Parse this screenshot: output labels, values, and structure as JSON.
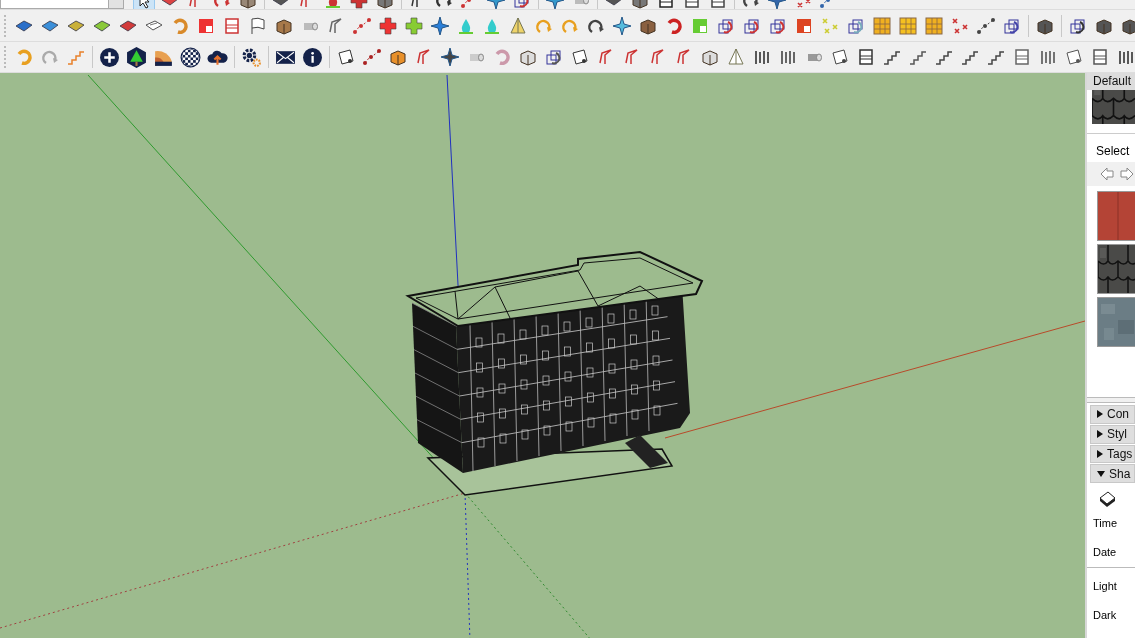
{
  "tray": {
    "materials": {
      "title": "Default",
      "current": {
        "kind": "shingle"
      },
      "select_label": "Select",
      "swatches": [
        {
          "kind": "brick",
          "selected": false
        },
        {
          "kind": "shingle",
          "selected": false
        },
        {
          "kind": "stone",
          "selected": false
        }
      ]
    },
    "sections": [
      {
        "label": "Con",
        "expanded": false
      },
      {
        "label": "Styl",
        "expanded": false
      },
      {
        "label": "Tags",
        "expanded": false
      },
      {
        "label": "Sha",
        "expanded": true,
        "fields": [
          {
            "label": "Time"
          },
          {
            "label": "Date"
          },
          {
            "label": "Light"
          },
          {
            "label": "Dark"
          }
        ]
      }
    ]
  }
}
